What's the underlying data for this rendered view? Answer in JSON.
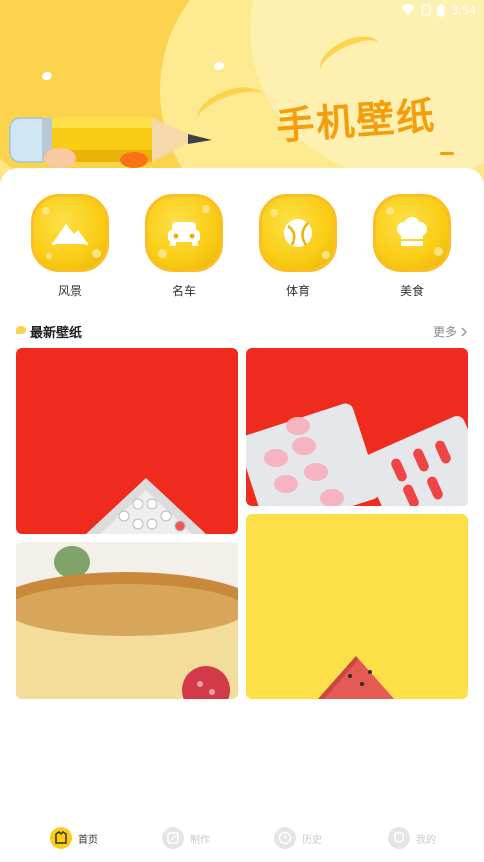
{
  "status_bar": {
    "time": "3:54",
    "icons": [
      "wifi-icon",
      "sim-icon",
      "battery-icon"
    ]
  },
  "banner": {
    "title": "手机壁纸"
  },
  "categories": [
    {
      "label": "风景",
      "icon": "landscape-icon"
    },
    {
      "label": "名车",
      "icon": "car-icon"
    },
    {
      "label": "体育",
      "icon": "ball-icon"
    },
    {
      "label": "美食",
      "icon": "chef-hat-icon"
    }
  ],
  "section": {
    "title": "最新壁纸",
    "more": "更多"
  },
  "wallpapers": [
    {
      "name": "red-pills-blister",
      "bg": "#ef2b1e"
    },
    {
      "name": "red-pills-pink",
      "bg": "#ef2b1e"
    },
    {
      "name": "cake-close-up",
      "bg": "#e8c98f"
    },
    {
      "name": "yellow-watermelon",
      "bg": "#fde047"
    }
  ],
  "bottom_nav": [
    {
      "label": "首页",
      "icon": "home-icon",
      "active": true
    },
    {
      "label": "制作",
      "icon": "edit-icon",
      "active": false
    },
    {
      "label": "历史",
      "icon": "clock-icon",
      "active": false
    },
    {
      "label": "我的",
      "icon": "user-icon",
      "active": false
    }
  ],
  "colors": {
    "accent": "#facc15",
    "accent_dark": "#f59e0b",
    "banner_bg": "#fde68a"
  }
}
